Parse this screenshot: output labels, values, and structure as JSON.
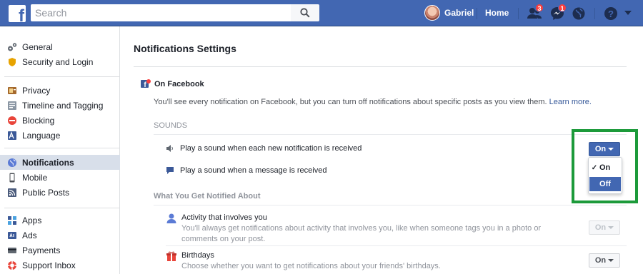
{
  "topbar": {
    "logo": "f",
    "search_placeholder": "Search",
    "user_name": "Gabriel",
    "home_label": "Home",
    "friend_requests_count": "3",
    "messages_count": "1"
  },
  "sidebar": {
    "group1": [
      {
        "label": "General",
        "icon": "gears-icon"
      },
      {
        "label": "Security and Login",
        "icon": "shield-icon"
      }
    ],
    "group2": [
      {
        "label": "Privacy",
        "icon": "privacy-icon"
      },
      {
        "label": "Timeline and Tagging",
        "icon": "timeline-icon"
      },
      {
        "label": "Blocking",
        "icon": "blocking-icon"
      },
      {
        "label": "Language",
        "icon": "language-icon"
      }
    ],
    "group3": [
      {
        "label": "Notifications",
        "icon": "globe-icon",
        "active": true
      },
      {
        "label": "Mobile",
        "icon": "mobile-icon"
      },
      {
        "label": "Public Posts",
        "icon": "rss-icon"
      }
    ],
    "group4": [
      {
        "label": "Apps",
        "icon": "apps-icon"
      },
      {
        "label": "Ads",
        "icon": "ads-icon"
      },
      {
        "label": "Payments",
        "icon": "payments-icon"
      },
      {
        "label": "Support Inbox",
        "icon": "lifebuoy-icon"
      }
    ]
  },
  "main": {
    "title": "Notifications Settings",
    "section_title": "On Facebook",
    "intro_text": "You'll see every notification on Facebook, but you can turn off notifications about specific posts as you view them.",
    "learn_more": "Learn more.",
    "sounds_header": "SOUNDS",
    "sound_new_notification": "Play a sound when each new notification is received",
    "sound_message": "Play a sound when a message is received",
    "sound_button_label": "On",
    "dropdown_options": [
      "On",
      "Off"
    ],
    "dropdown_selected": "On",
    "notified_header": "What You Get Notified About",
    "activity_title": "Activity that involves you",
    "activity_desc": "You'll always get notifications about activity that involves you, like when someone tags you in a photo or comments on your post.",
    "activity_button": "On",
    "birthdays_title": "Birthdays",
    "birthdays_desc": "Choose whether you want to get notifications about your friends' birthdays.",
    "birthdays_button": "On"
  },
  "colors": {
    "brand": "#4267b2",
    "highlight_box": "#1c9a3a",
    "link": "#365899"
  }
}
